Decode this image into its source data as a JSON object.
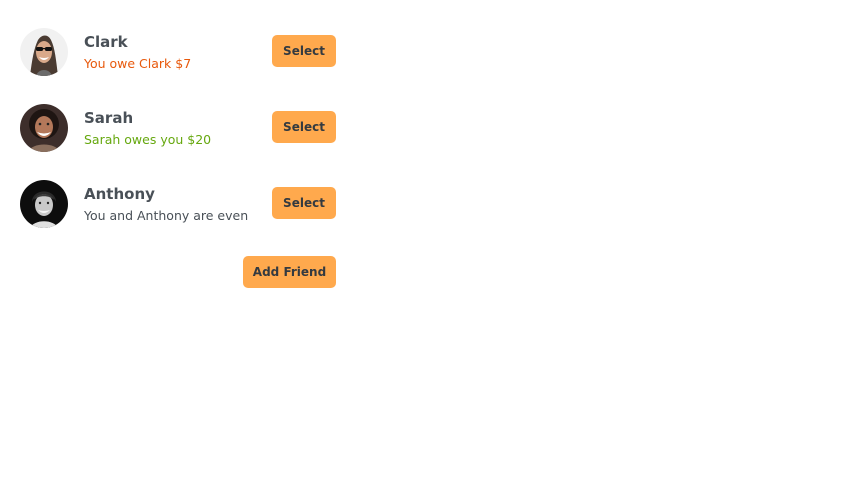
{
  "friends": [
    {
      "name": "Clark",
      "status": "You owe Clark $7",
      "status_type": "owe",
      "button_label": "Select"
    },
    {
      "name": "Sarah",
      "status": "Sarah owes you $20",
      "status_type": "owed",
      "button_label": "Select"
    },
    {
      "name": "Anthony",
      "status": "You and Anthony are even",
      "status_type": "even",
      "button_label": "Select"
    }
  ],
  "add_friend_label": "Add Friend",
  "colors": {
    "accent": "#ffa94d",
    "owe": "#e8590c",
    "owed": "#66a80f",
    "text": "#495057"
  }
}
